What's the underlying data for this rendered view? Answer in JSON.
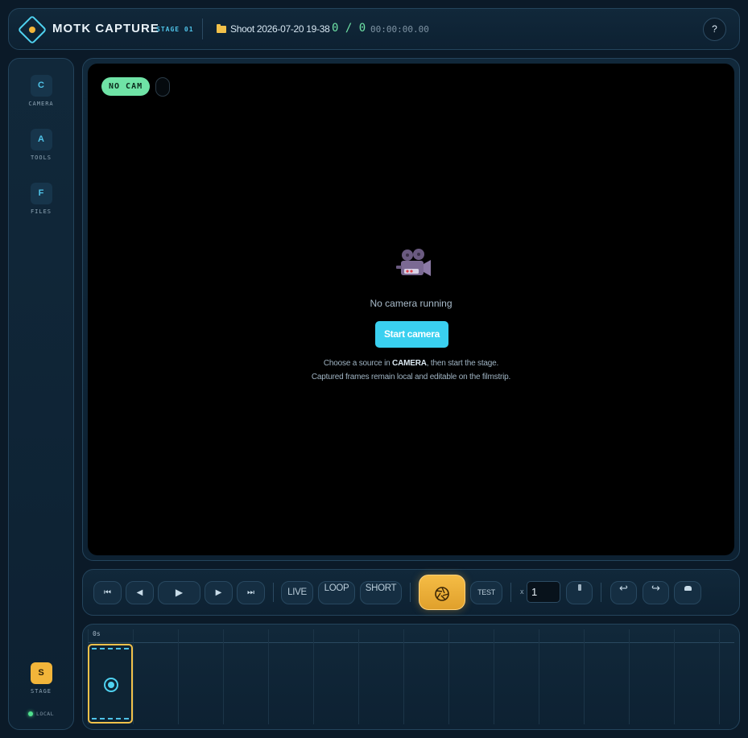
{
  "header": {
    "app_title": "MOTK CAPTURE",
    "stage_tag": "STAGE 01",
    "shoot_name": "Shoot 2026-07-20 19-38",
    "frame_count": "0 / 0",
    "timecode": "00:00:00.00",
    "help_label": "?"
  },
  "sidebar": {
    "items": [
      {
        "key": "C",
        "label": "CAMERA"
      },
      {
        "key": "A",
        "label": "TOOLS"
      },
      {
        "key": "F",
        "label": "FILES"
      }
    ],
    "stage": {
      "key": "S",
      "label": "STAGE"
    },
    "status": "LOCAL"
  },
  "viewer": {
    "badge": "NO CAM",
    "message": "No camera running",
    "start_button": "Start camera",
    "hint_line1_prefix": "Choose a source in ",
    "hint_line1_bold": "CAMERA",
    "hint_line1_suffix": ", then start the stage.",
    "hint_line2": "Captured frames remain local and editable on the filmstrip."
  },
  "transport": {
    "first_icon": "⏮",
    "prev_icon": "◀",
    "play_icon": "▶",
    "next_icon": "▶",
    "last_icon": "⏭",
    "live_label": "LIVE",
    "loop_label": "LOOP",
    "short_label": "SHORT",
    "capture_icon": "aperture-icon",
    "test_label": "TEST",
    "multiplier_prefix": "x",
    "multiplier_value": "1",
    "undo_icon": "↩",
    "redo_icon": "↪"
  },
  "timeline": {
    "ruler_start": "0s"
  },
  "colors": {
    "accent": "#4fc3e8",
    "brand_gold": "#f2b53a",
    "live_green": "#6fe3a6",
    "background": "#0b1a28"
  }
}
